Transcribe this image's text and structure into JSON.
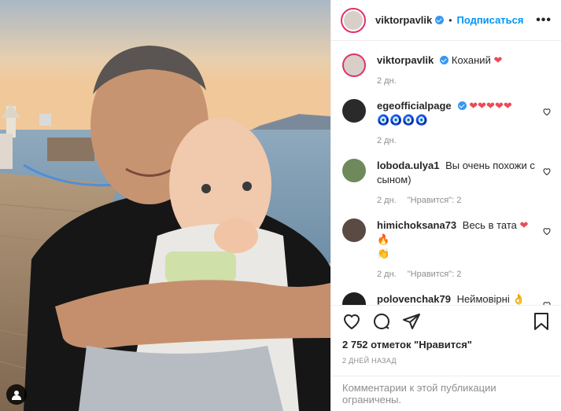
{
  "post": {
    "author": "viktorpavlik",
    "follow_label": "Подписаться",
    "dot": "•"
  },
  "comments": [
    {
      "user": "viktorpavlik",
      "text": "Коханий",
      "emoji": "❤",
      "time": "2 дн.",
      "likes": ""
    },
    {
      "user": "egeofficialpage",
      "text": "",
      "emoji": "❤❤❤❤❤",
      "extra": "🧿🧿🧿🧿",
      "time": "2 дн.",
      "likes": ""
    },
    {
      "user": "loboda.ulya1",
      "text": "Вы очень похожи с сыном)",
      "emoji": "",
      "time": "2 дн.",
      "likes": "\"Нравится\": 2"
    },
    {
      "user": "himichoksana73",
      "text": "Весь в тата",
      "emoji": "❤🔥",
      "extra": "👏",
      "time": "2 дн.",
      "likes": "\"Нравится\": 2"
    },
    {
      "user": "polovenchak79",
      "text": "Неймовірні",
      "emoji": "👌",
      "time": "",
      "likes": ""
    }
  ],
  "footer": {
    "likes_label": "2 752 отметок \"Нравится\"",
    "date_label": "2 ДНЕЙ НАЗАД",
    "comments_limited": "Комментарии к этой публикации ограничены."
  },
  "colors": {
    "accent": "#0095f6",
    "heart": "#ed4956",
    "muted": "#8e8e8e"
  },
  "icons": [
    "more-options-icon",
    "heart-icon",
    "comment-icon",
    "share-icon",
    "bookmark-icon",
    "tag-user-icon",
    "verified-badge-icon"
  ]
}
